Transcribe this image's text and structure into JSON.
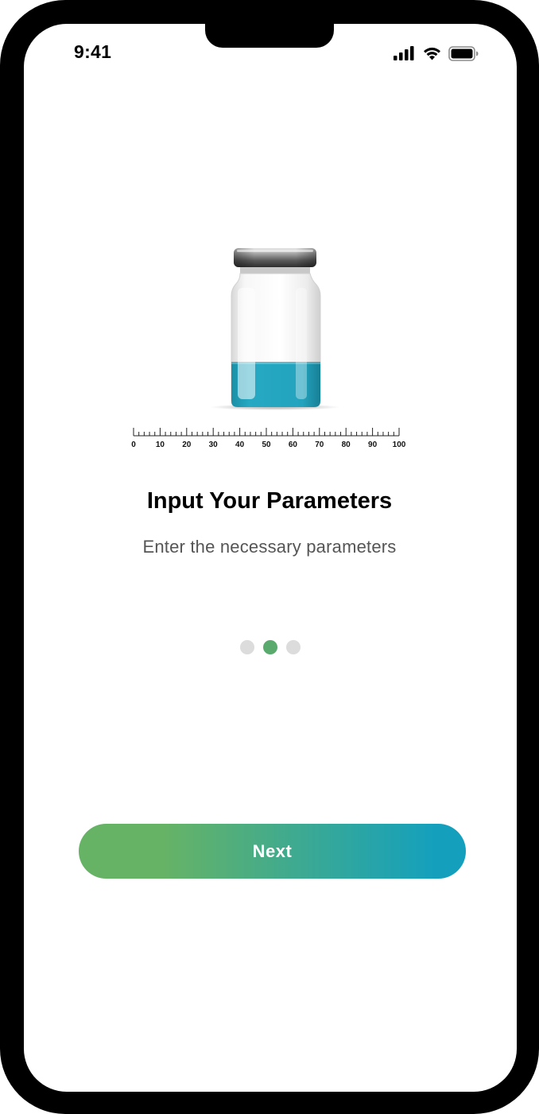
{
  "status_bar": {
    "time": "9:41",
    "icons": [
      "cellular-signal-icon",
      "wifi-icon",
      "battery-icon"
    ]
  },
  "onboarding": {
    "illustration": {
      "name": "vial-with-measuring-ruler",
      "ruler_labels": [
        "0",
        "10",
        "20",
        "30",
        "40",
        "50",
        "60",
        "70",
        "80",
        "90",
        "100"
      ]
    },
    "title": "Input Your Parameters",
    "subtitle": "Enter the necessary parameters",
    "pager": {
      "total_pages": 3,
      "current_page": 2
    },
    "next_button_label": "Next"
  },
  "colors": {
    "device_frame": "#000000",
    "screen_background": "#ffffff",
    "title_text": "#000000",
    "subtitle_text": "#555555",
    "dot_active": "#5aaa6e",
    "dot_inactive": "#dcdcdc",
    "button_gradient_start": "#66b366",
    "button_gradient_end": "#14a0bd",
    "liquid": "#23a3bd"
  }
}
